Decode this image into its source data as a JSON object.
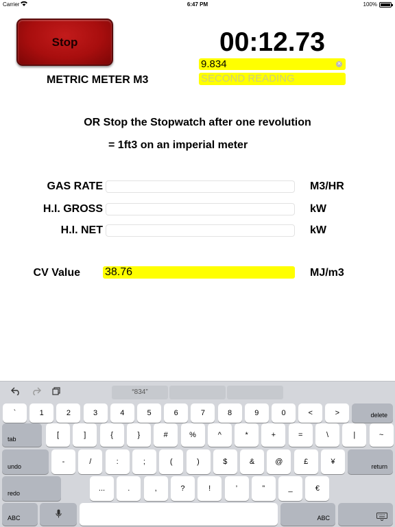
{
  "status_bar": {
    "carrier": "Carrier",
    "time": "6:47 PM",
    "battery": "100%"
  },
  "stop_button": {
    "label": "Stop"
  },
  "timer": {
    "display": "00:12.73"
  },
  "meter": {
    "label": "METRIC METER M3"
  },
  "first_reading": {
    "value": "9.834"
  },
  "second_reading": {
    "placeholder": "SECOND READING"
  },
  "instructions": {
    "line1": "OR Stop the Stopwatch after one revolution",
    "line2": "= 1ft3 on an imperial meter"
  },
  "results": [
    {
      "label": "GAS RATE",
      "value": "",
      "unit": "M3/HR"
    },
    {
      "label": "H.I. GROSS",
      "value": "",
      "unit": "kW"
    },
    {
      "label": "H.I. NET",
      "value": "",
      "unit": "kW"
    }
  ],
  "cv": {
    "label": "CV Value",
    "value": "38.76",
    "unit": "MJ/m3"
  },
  "colors": {
    "highlight": "#ffff00",
    "stop_button": "#a80e0e",
    "keyboard_bg": "#d4d6db"
  },
  "keyboard": {
    "assistant": {
      "icons": [
        "undo-arrow-icon",
        "redo-arrow-icon",
        "clipboard-icon"
      ],
      "suggestions": [
        "“834”",
        "",
        ""
      ]
    },
    "row1": [
      "`",
      "1",
      "2",
      "3",
      "4",
      "5",
      "6",
      "7",
      "8",
      "9",
      "0",
      "<",
      ">"
    ],
    "delete": "delete",
    "tab": "tab",
    "row2": [
      "[",
      "]",
      "{",
      "}",
      "#",
      "%",
      "^",
      "*",
      "+",
      "=",
      "\\",
      "|",
      "~"
    ],
    "undo": "undo",
    "row3": [
      "-",
      "/",
      ":",
      ";",
      "(",
      ")",
      "$",
      "&",
      "@",
      "£",
      "¥"
    ],
    "return": "return",
    "redo": "redo",
    "row4": [
      "...",
      ".",
      ",",
      "?",
      "!",
      "’",
      "”",
      "_",
      "€"
    ],
    "abc_left": "ABC",
    "abc_right": "ABC",
    "icons": [
      "microphone-icon",
      "keyboard-dismiss-icon"
    ]
  }
}
